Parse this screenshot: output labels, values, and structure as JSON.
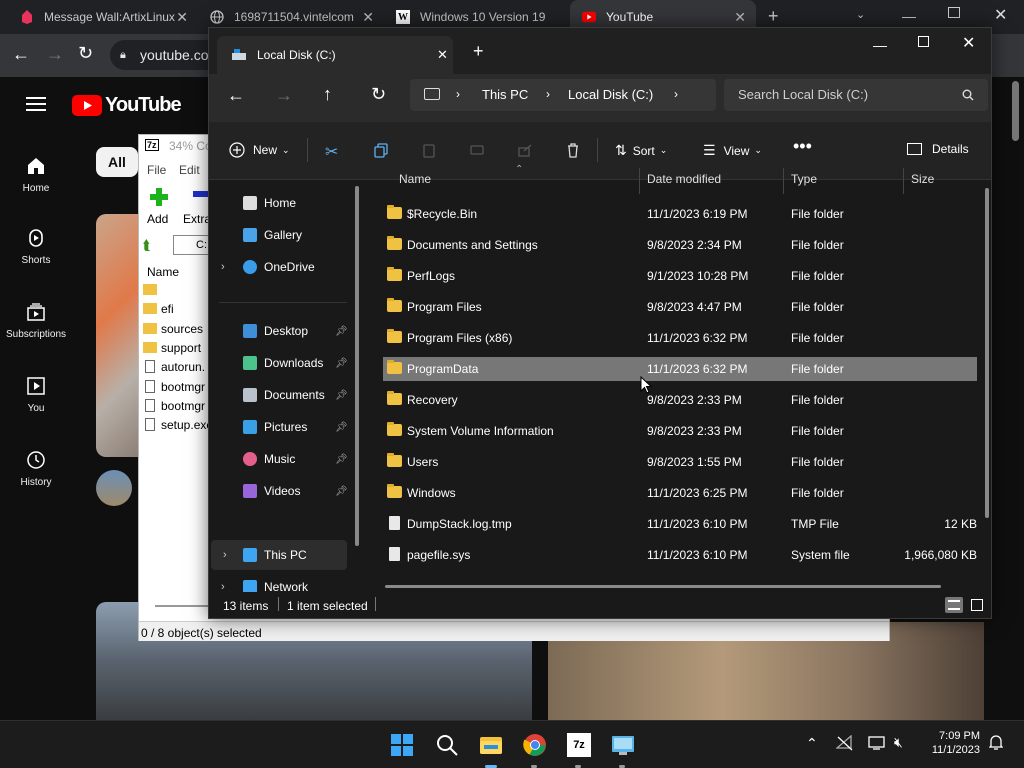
{
  "chrome": {
    "tabs": [
      {
        "title": "Message Wall:ArtixLinux",
        "icon": "fandom-icon"
      },
      {
        "title": "1698711504.vintelcom",
        "icon": "globe-icon"
      },
      {
        "title": "Windows 10 Version 19",
        "icon": "wikipedia-icon"
      },
      {
        "title": "YouTube",
        "icon": "youtube-icon"
      }
    ],
    "url": "youtube.co"
  },
  "youtube": {
    "logo_text": "YouTube",
    "nav": [
      {
        "label": "Home",
        "icon": "home-icon"
      },
      {
        "label": "Shorts",
        "icon": "shorts-icon"
      },
      {
        "label": "Subscriptions",
        "icon": "subscriptions-icon"
      },
      {
        "label": "You",
        "icon": "you-icon"
      },
      {
        "label": "History",
        "icon": "history-icon"
      }
    ],
    "chip_all": "All"
  },
  "sevenzip": {
    "title": "34% Co",
    "menu": [
      "File",
      "Edit"
    ],
    "toolbar": [
      "Add",
      "Extra"
    ],
    "path": "C:",
    "column_name": "Name",
    "items": [
      "",
      "efi",
      "sources",
      "support",
      "autorun.",
      "bootmgr",
      "bootmgr",
      "setup.exe"
    ],
    "status": "0 / 8 object(s) selected"
  },
  "explorer": {
    "tab_title": "Local Disk (C:)",
    "breadcrumb": [
      "This PC",
      "Local Disk (C:)"
    ],
    "search_placeholder": "Search Local Disk (C:)",
    "commands": {
      "new": "New",
      "sort": "Sort",
      "view": "View",
      "details": "Details"
    },
    "sidebar": [
      {
        "label": "Home",
        "icon": "home-icon",
        "pinned": false
      },
      {
        "label": "Gallery",
        "icon": "gallery-icon",
        "pinned": false
      },
      {
        "label": "OneDrive",
        "icon": "onedrive-icon",
        "pinned": false,
        "expandable": true
      },
      {
        "label": "Desktop",
        "icon": "desktop-icon",
        "pinned": true
      },
      {
        "label": "Downloads",
        "icon": "downloads-icon",
        "pinned": true
      },
      {
        "label": "Documents",
        "icon": "documents-icon",
        "pinned": true
      },
      {
        "label": "Pictures",
        "icon": "pictures-icon",
        "pinned": true
      },
      {
        "label": "Music",
        "icon": "music-icon",
        "pinned": true
      },
      {
        "label": "Videos",
        "icon": "videos-icon",
        "pinned": true
      },
      {
        "label": "This PC",
        "icon": "this-pc-icon",
        "pinned": false,
        "expandable": true
      },
      {
        "label": "Network",
        "icon": "network-icon",
        "pinned": false,
        "expandable": true
      }
    ],
    "columns": {
      "name": "Name",
      "date": "Date modified",
      "type": "Type",
      "size": "Size"
    },
    "files": [
      {
        "name": "$Recycle.Bin",
        "date": "11/1/2023 6:19 PM",
        "type": "File folder",
        "size": "",
        "kind": "folder"
      },
      {
        "name": "Documents and Settings",
        "date": "9/8/2023 2:34 PM",
        "type": "File folder",
        "size": "",
        "kind": "folder"
      },
      {
        "name": "PerfLogs",
        "date": "9/1/2023 10:28 PM",
        "type": "File folder",
        "size": "",
        "kind": "folder"
      },
      {
        "name": "Program Files",
        "date": "9/8/2023 4:47 PM",
        "type": "File folder",
        "size": "",
        "kind": "folder"
      },
      {
        "name": "Program Files (x86)",
        "date": "11/1/2023 6:32 PM",
        "type": "File folder",
        "size": "",
        "kind": "folder"
      },
      {
        "name": "ProgramData",
        "date": "11/1/2023 6:32 PM",
        "type": "File folder",
        "size": "",
        "kind": "folder",
        "selected": true
      },
      {
        "name": "Recovery",
        "date": "9/8/2023 2:33 PM",
        "type": "File folder",
        "size": "",
        "kind": "folder"
      },
      {
        "name": "System Volume Information",
        "date": "9/8/2023 2:33 PM",
        "type": "File folder",
        "size": "",
        "kind": "folder"
      },
      {
        "name": "Users",
        "date": "9/8/2023 1:55 PM",
        "type": "File folder",
        "size": "",
        "kind": "folder"
      },
      {
        "name": "Windows",
        "date": "11/1/2023 6:25 PM",
        "type": "File folder",
        "size": "",
        "kind": "folder"
      },
      {
        "name": "DumpStack.log.tmp",
        "date": "11/1/2023 6:10 PM",
        "type": "TMP File",
        "size": "12 KB",
        "kind": "file"
      },
      {
        "name": "pagefile.sys",
        "date": "11/1/2023 6:10 PM",
        "type": "System file",
        "size": "1,966,080 KB",
        "kind": "file"
      }
    ],
    "status": {
      "items": "13 items",
      "selected": "1 item selected"
    }
  },
  "taskbar": {
    "time": "7:09 PM",
    "date": "11/1/2023"
  },
  "colors": {
    "selection": "#777777",
    "folder": "#f0c244",
    "youtube_red": "#ff0000"
  }
}
